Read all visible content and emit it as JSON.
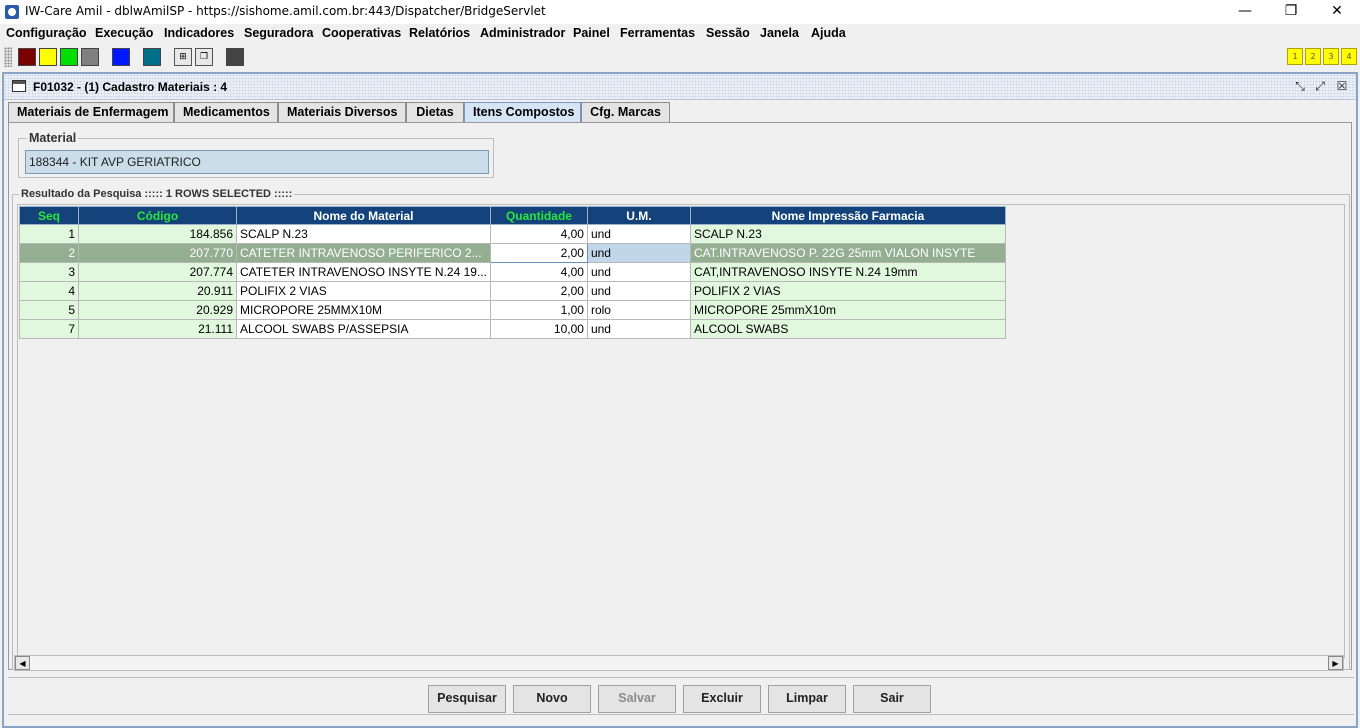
{
  "window": {
    "title": "IW-Care Amil - dblwAmilSP - https://sishome.amil.com.br:443/Dispatcher/BridgeServlet",
    "minimize": "—",
    "restore": "❐",
    "close": "✕"
  },
  "menu": [
    "Configuração",
    "Execução",
    "Indicadores",
    "Seguradora",
    "Cooperativas",
    "Relatórios",
    "Administrador",
    "Painel",
    "Ferramentas",
    "Sessão",
    "Janela",
    "Ajuda"
  ],
  "toolbar": {
    "swatches": [
      "#7a0000",
      "#ffff00",
      "#00e000",
      "#808080",
      "#0018ff",
      "#006f8a"
    ],
    "window_numbers": [
      "1",
      "2",
      "3",
      "4"
    ]
  },
  "frame": {
    "title": "F01032 - (1) Cadastro Materiais : 4",
    "ctl_restore": "⤡",
    "ctl_max": "⤢",
    "ctl_close": "☒"
  },
  "tabs": [
    "Materiais de Enfermagem",
    "Medicamentos",
    "Materiais Diversos",
    "Dietas",
    "Itens Compostos",
    "Cfg. Marcas"
  ],
  "active_tab": "Itens Compostos",
  "material": {
    "legend": "Material",
    "value": "188344 - KIT AVP GERIATRICO"
  },
  "results": {
    "legend": "Resultado da Pesquisa ::::: 1 ROWS SELECTED :::::",
    "columns": [
      "Seq",
      "Código",
      "Nome do Material",
      "Quantidade",
      "U.M.",
      "Nome Impressão Farmacia"
    ],
    "rows": [
      {
        "seq": "1",
        "codigo": "184.856",
        "nome": "SCALP N.23",
        "qtd": "4,00",
        "um": "und",
        "farmacia": "SCALP N.23"
      },
      {
        "seq": "2",
        "codigo": "207.770",
        "nome": "CATETER INTRAVENOSO PERIFERICO 2...",
        "qtd": "2,00",
        "um": "und",
        "farmacia": "CAT.INTRAVENOSO P. 22G 25mm VIALON INSYTE"
      },
      {
        "seq": "3",
        "codigo": "207.774",
        "nome": "CATETER INTRAVENOSO INSYTE N.24 19...",
        "qtd": "4,00",
        "um": "und",
        "farmacia": "CAT,INTRAVENOSO INSYTE N.24 19mm"
      },
      {
        "seq": "4",
        "codigo": "20.911",
        "nome": "POLIFIX 2 VIAS",
        "qtd": "2,00",
        "um": "und",
        "farmacia": "POLIFIX 2 VIAS"
      },
      {
        "seq": "5",
        "codigo": "20.929",
        "nome": "MICROPORE 25MMX10M",
        "qtd": "1,00",
        "um": "rolo",
        "farmacia": "MICROPORE 25mmX10m"
      },
      {
        "seq": "7",
        "codigo": "21.111",
        "nome": "ALCOOL SWABS P/ASSEPSIA",
        "qtd": "10,00",
        "um": "und",
        "farmacia": "ALCOOL SWABS"
      }
    ]
  },
  "buttons": {
    "pesquisar": "Pesquisar",
    "novo": "Novo",
    "salvar": "Salvar",
    "excluir": "Excluir",
    "limpar": "Limpar",
    "sair": "Sair"
  }
}
